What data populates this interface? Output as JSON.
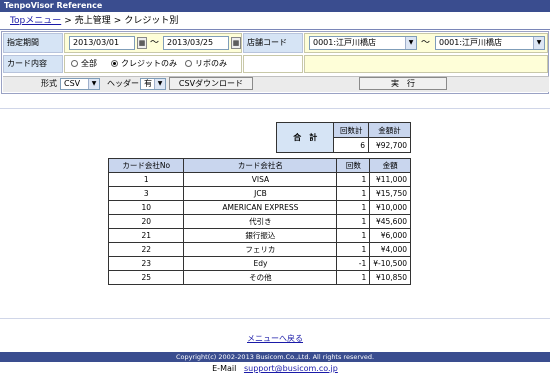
{
  "app_title": "TenpoVisor Reference",
  "breadcrumb": {
    "top": "Topメニュー",
    "sep": ">",
    "section": "売上管理",
    "current": "クレジット別"
  },
  "form": {
    "period_label": "指定期間",
    "date_from": "2013/03/01",
    "date_to": "2013/03/25",
    "tilde": "〜",
    "store_label": "店舗コード",
    "store_from": "0001:江戸川橋店",
    "store_to": "0001:江戸川橋店",
    "card_label": "カード内容",
    "options": [
      "全部",
      "クレジットのみ",
      "リボのみ"
    ],
    "selected_option": "クレジットのみ"
  },
  "options_row": {
    "format_label": "形式",
    "format_value": "CSV",
    "header_label": "ヘッダー",
    "header_value": "有",
    "csv_button": "CSVダウンロード",
    "run_button": "実　行"
  },
  "summary": {
    "label": "合　計",
    "count_header": "回数計",
    "amount_header": "金額計",
    "count": "6",
    "amount": "¥92,700"
  },
  "table": {
    "headers": [
      "カード会社No",
      "カード会社名",
      "回数",
      "金額"
    ],
    "rows": [
      [
        "1",
        "VISA",
        "1",
        "¥11,000"
      ],
      [
        "3",
        "JCB",
        "1",
        "¥15,750"
      ],
      [
        "10",
        "AMERICAN EXPRESS",
        "1",
        "¥10,000"
      ],
      [
        "20",
        "代引き",
        "1",
        "¥45,600"
      ],
      [
        "21",
        "銀行振込",
        "1",
        "¥6,000"
      ],
      [
        "22",
        "フェリカ",
        "1",
        "¥4,000"
      ],
      [
        "23",
        "Edy",
        "-1",
        "¥-10,500"
      ],
      [
        "25",
        "その他",
        "1",
        "¥10,850"
      ]
    ]
  },
  "back_link": "メニューへ戻る",
  "footer": {
    "copyright": "Copyright(c) 2002-2013 Busicom.Co.,Ltd. All rights reserved.",
    "email_label": "E-Mail",
    "email": "support@busicom.co.jp"
  },
  "colors": {
    "header_bar": "#3a4d8f",
    "label_bg": "#d6e4f5",
    "input_cell_bg": "#fefed8",
    "table_header_bg": "#c9d6ee",
    "link": "#1a1aa8"
  }
}
